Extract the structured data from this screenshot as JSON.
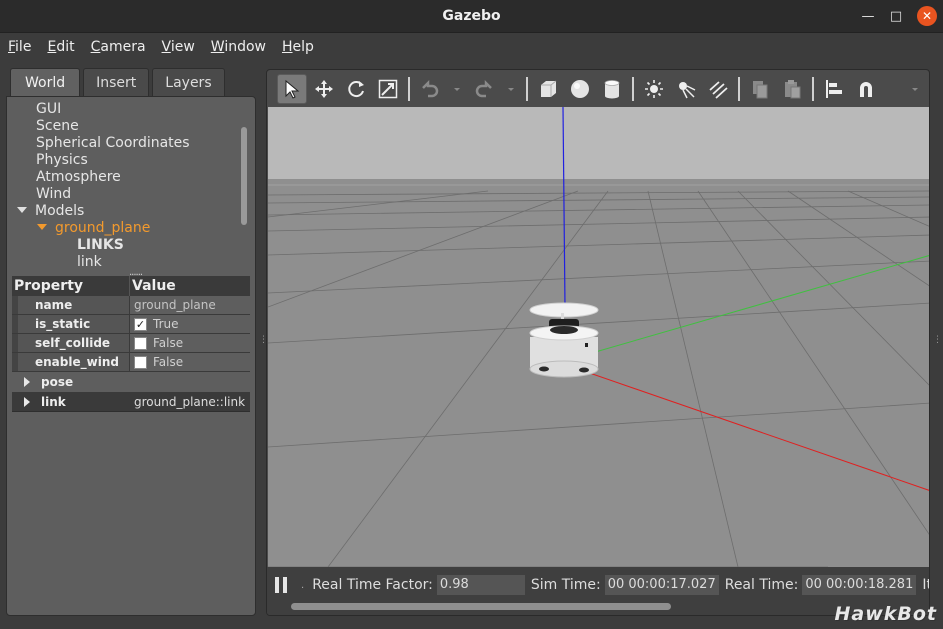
{
  "window": {
    "title": "Gazebo"
  },
  "menu": [
    {
      "label": "File",
      "hot": "F",
      "rest": "ile"
    },
    {
      "label": "Edit",
      "hot": "E",
      "rest": "dit"
    },
    {
      "label": "Camera",
      "hot": "C",
      "rest": "amera"
    },
    {
      "label": "View",
      "hot": "V",
      "rest": "iew"
    },
    {
      "label": "Window",
      "hot": "W",
      "rest": "indow"
    },
    {
      "label": "Help",
      "hot": "H",
      "rest": "elp"
    }
  ],
  "left_panel": {
    "tabs": [
      "World",
      "Insert",
      "Layers"
    ],
    "active_tab": "World",
    "tree": {
      "items": [
        "GUI",
        "Scene",
        "Spherical Coordinates",
        "Physics",
        "Atmosphere",
        "Wind"
      ],
      "models_label": "Models",
      "selected_model": "ground_plane",
      "links_label": "LINKS",
      "link_label": "link"
    },
    "properties": {
      "header": {
        "property": "Property",
        "value": "Value"
      },
      "rows": {
        "name": {
          "label": "name",
          "value": "ground_plane"
        },
        "is_static": {
          "label": "is_static",
          "value": "True",
          "checked": true
        },
        "self_collide": {
          "label": "self_collide",
          "value": "False",
          "checked": false
        },
        "enable_wind": {
          "label": "enable_wind",
          "value": "False",
          "checked": false
        }
      },
      "pose_label": "pose",
      "link": {
        "label": "link",
        "value": "ground_plane::link"
      }
    }
  },
  "toolbar": {
    "tools": [
      "select-mode",
      "translate-mode",
      "rotate-mode",
      "scale-mode",
      "undo",
      "redo",
      "box",
      "sphere",
      "cylinder",
      "point-light",
      "spot-light",
      "directional-light",
      "copy",
      "paste",
      "align",
      "snap"
    ]
  },
  "status": {
    "real_time_factor_label": "Real Time Factor:",
    "real_time_factor": "0.98",
    "sim_time_label": "Sim Time:",
    "sim_time": "00 00:00:17.027",
    "real_time_label": "Real Time:",
    "real_time": "00 00:00:18.281",
    "iterations_label_partial": "It"
  },
  "watermark": "HawkBot",
  "colors": {
    "accent_orange": "#f39a2d",
    "close_button": "#e95420",
    "sky": "#b8b8b8",
    "ground": "#8c8c8c",
    "axis_x": "#e02020",
    "axis_y": "#40c040",
    "axis_z": "#2020e0"
  }
}
